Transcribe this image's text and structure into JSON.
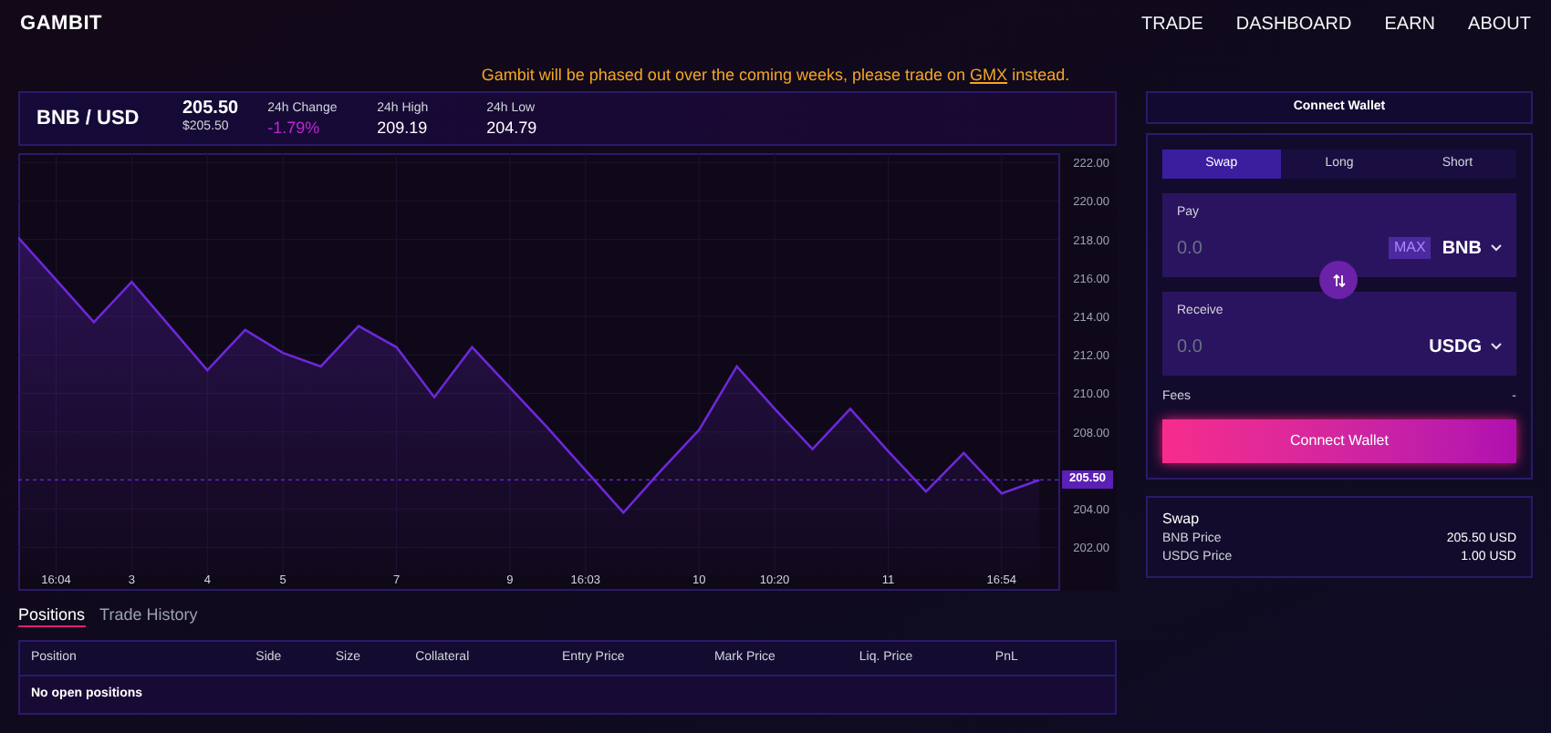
{
  "header": {
    "logo": "GAMBIT",
    "nav": [
      {
        "label": "TRADE"
      },
      {
        "label": "DASHBOARD"
      },
      {
        "label": "EARN"
      },
      {
        "label": "ABOUT"
      }
    ]
  },
  "banner": {
    "before": "Gambit will be phased out over the coming weeks, please trade on",
    "link": "GMX",
    "after": "instead."
  },
  "ticker": {
    "pair": "BNB / USD",
    "price": "205.50",
    "price_sub": "$205.50",
    "stats": [
      {
        "label": "24h Change",
        "value": "-1.79%",
        "kind": "change"
      },
      {
        "label": "24h High",
        "value": "209.19",
        "kind": "plain"
      },
      {
        "label": "24h Low",
        "value": "204.79",
        "kind": "plain"
      }
    ]
  },
  "chart": {
    "price_tag": "205.50",
    "chart_data": {
      "type": "area",
      "grid": true,
      "ref_lines": [
        {
          "axis": "y",
          "value": 205.5,
          "color": "#6d28d9"
        }
      ],
      "categories": [
        null,
        "16:04",
        null,
        "3",
        null,
        "4",
        null,
        "5",
        null,
        null,
        "7",
        null,
        null,
        "9",
        null,
        "16:03",
        null,
        null,
        "10",
        null,
        "10:20",
        null,
        null,
        "11",
        null,
        null,
        "16:54",
        null
      ],
      "series": [
        {
          "color": "#6d28d9",
          "values": [
            218.1,
            215.9,
            213.7,
            215.8,
            213.5,
            211.2,
            213.3,
            212.1,
            211.4,
            213.5,
            212.4,
            209.8,
            212.4,
            210.3,
            208.2,
            206.0,
            203.8,
            206.0,
            208.1,
            211.4,
            209.2,
            207.1,
            209.2,
            207.0,
            204.9,
            206.9,
            204.8,
            205.5
          ]
        }
      ],
      "ylim": [
        200.5,
        222.2
      ],
      "yticks": [
        {
          "value": 202,
          "label": "202.00"
        },
        {
          "value": 204,
          "label": "204.00"
        },
        {
          "value": 208,
          "label": "208.00"
        },
        {
          "value": 210,
          "label": "210.00"
        },
        {
          "value": 212,
          "label": "212.00"
        },
        {
          "value": 214,
          "label": "214.00"
        },
        {
          "value": 216,
          "label": "216.00"
        },
        {
          "value": 218,
          "label": "218.00"
        },
        {
          "value": 220,
          "label": "220.00"
        },
        {
          "value": 222,
          "label": "222.00"
        }
      ]
    }
  },
  "positions": {
    "tabs": [
      {
        "label": "Positions",
        "selected": true
      },
      {
        "label": "Trade History",
        "selected": false
      }
    ],
    "columns": [
      "Position",
      "Side",
      "Size",
      "Collateral",
      "Entry Price",
      "Mark Price",
      "Liq. Price",
      "PnL"
    ],
    "empty": "No open positions"
  },
  "wallet_button": "Connect Wallet",
  "swap": {
    "tabs": [
      {
        "label": "Swap",
        "selected": true
      },
      {
        "label": "Long",
        "selected": false
      },
      {
        "label": "Short",
        "selected": false
      }
    ],
    "pay": {
      "label": "Pay",
      "placeholder": "0.0",
      "max": "MAX",
      "token": "BNB"
    },
    "receive": {
      "label": "Receive",
      "placeholder": "0.0",
      "token": "USDG"
    },
    "fees_label": "Fees",
    "fees_value": "-",
    "button": "Connect Wallet"
  },
  "info": {
    "title": "Swap",
    "rows": [
      {
        "label": "BNB Price",
        "value": "205.50 USD"
      },
      {
        "label": "USDG Price",
        "value": "1.00 USD"
      }
    ]
  }
}
